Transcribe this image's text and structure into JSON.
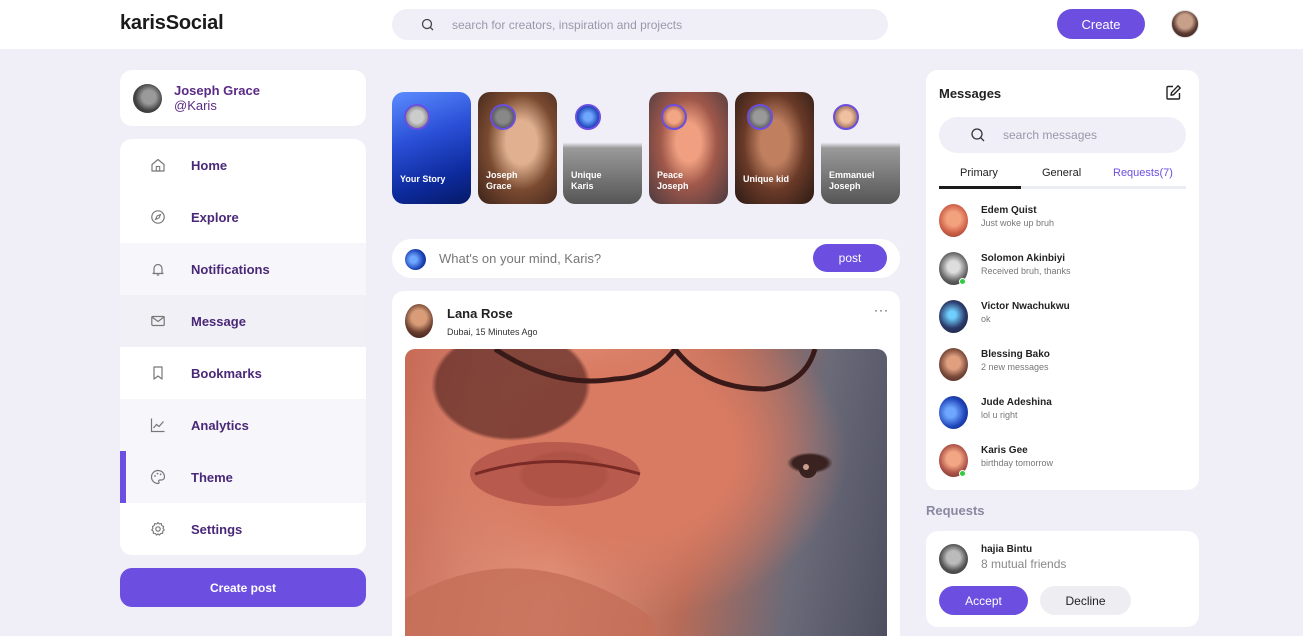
{
  "app": {
    "logo": "karisSocial"
  },
  "header": {
    "search_placeholder": "search for creators, inspiration and projects",
    "create_label": "Create"
  },
  "profile": {
    "name": "Joseph Grace",
    "handle": "@Karis"
  },
  "sidebar": {
    "items": [
      {
        "label": "Home",
        "icon": "home-icon"
      },
      {
        "label": "Explore",
        "icon": "compass-icon"
      },
      {
        "label": "Notifications",
        "icon": "bell-icon"
      },
      {
        "label": "Message",
        "icon": "mail-icon"
      },
      {
        "label": "Bookmarks",
        "icon": "bookmark-icon"
      },
      {
        "label": "Analytics",
        "icon": "chart-icon"
      },
      {
        "label": "Theme",
        "icon": "palette-icon"
      },
      {
        "label": "Settings",
        "icon": "gear-icon"
      }
    ],
    "active": "Theme",
    "create_post_label": "Create post"
  },
  "stories": [
    {
      "line1": "Your Story",
      "line2": ""
    },
    {
      "line1": "Joseph",
      "line2": "Grace"
    },
    {
      "line1": "Unique",
      "line2": "Karis"
    },
    {
      "line1": "Peace",
      "line2": "Joseph"
    },
    {
      "line1": "Unique kid",
      "line2": ""
    },
    {
      "line1": "Emmanuel",
      "line2": "Joseph"
    }
  ],
  "composer": {
    "placeholder": "What's on your mind, Karis?",
    "post_label": "post"
  },
  "feed": {
    "author": "Lana Rose",
    "meta": "Dubai, 15 Minutes Ago",
    "more": "···"
  },
  "messages": {
    "title": "Messages",
    "search_placeholder": "search messages",
    "tabs": [
      "Primary",
      "General",
      "Requests(7)"
    ],
    "active_tab": "Primary",
    "contacts": [
      {
        "name": "Edem Quist",
        "text": "Just woke up bruh",
        "online": false
      },
      {
        "name": "Solomon Akinbiyi",
        "text": "Received bruh, thanks",
        "online": true
      },
      {
        "name": "Victor Nwachukwu",
        "text": "ok",
        "online": false
      },
      {
        "name": "Blessing Bako",
        "text": "2 new messages",
        "online": false
      },
      {
        "name": "Jude Adeshina",
        "text": "lol u right",
        "online": false
      },
      {
        "name": "Karis Gee",
        "text": "birthday tomorrow",
        "online": true
      }
    ]
  },
  "requests": {
    "title": "Requests",
    "name": "hajia Bintu",
    "mutual": "8 mutual friends",
    "accept_label": "Accept",
    "decline_label": "Decline"
  },
  "colors": {
    "accent": "#6c4ee0",
    "nav_text": "#4a2878",
    "background": "#f0eff8"
  }
}
